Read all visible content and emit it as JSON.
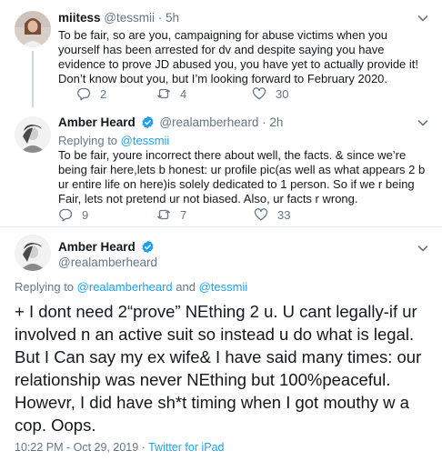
{
  "tweets": [
    {
      "name": "miitess",
      "handle": "@tessmii",
      "separator": "·",
      "time": "5h",
      "text": "To be fair, so are you, campaigning for abuse victims when you yourself has been arrested for dv and despite saying you have evidence to prove JD abused you, you have yet to actually provide it! Don’t know bout you, but I’m looking forward to February 2020.",
      "replies": "2",
      "retweets": "4",
      "likes": "30"
    },
    {
      "name": "Amber Heard",
      "verified": true,
      "handle": "@realamberheard",
      "separator": "·",
      "time": "2h",
      "replying_prefix": "Replying to",
      "replying_to": "@tessmii",
      "text": "To be fair, youre incorrect there about well, the facts. & since we’re being fair here,lets b honest: ur profile pic(as well as what appears 2 b ur entire life on here)is solely dedicated to 1 person. So if we r being Fair, lets not pretend ur not biased. Also, ur facts r wrong.",
      "replies": "9",
      "retweets": "7",
      "likes": "33"
    }
  ],
  "main_tweet": {
    "name": "Amber Heard",
    "verified": true,
    "handle": "@realamberheard",
    "replying_prefix": "Replying to",
    "replying_to_1": "@realamberheard",
    "replying_and": "and",
    "replying_to_2": "@tessmii",
    "text": "+ I dont need 2“prove” NEthing 2 u. U cant legally-if ur involved n an active suit so instead u do what is legal. But I Can say my ex wife& I have said many times: our relationship was never NEthing but 100%peaceful. Howevr, I did have sh*t timing when I got mouthy w a cop. Oops.",
    "timestamp": "10:22 PM - Oct 29, 2019",
    "meta_separator": "·",
    "source": "Twitter for iPad"
  },
  "icons": {
    "reply": "reply-icon",
    "retweet": "retweet-icon",
    "like": "heart-icon",
    "more": "chevron-down-icon",
    "verified": "verified-badge-icon"
  },
  "colors": {
    "text": "#14171a",
    "secondary": "#657786",
    "link": "#1da1f2",
    "divider": "#e6ecf0",
    "thread_line": "#ccd6dd"
  }
}
